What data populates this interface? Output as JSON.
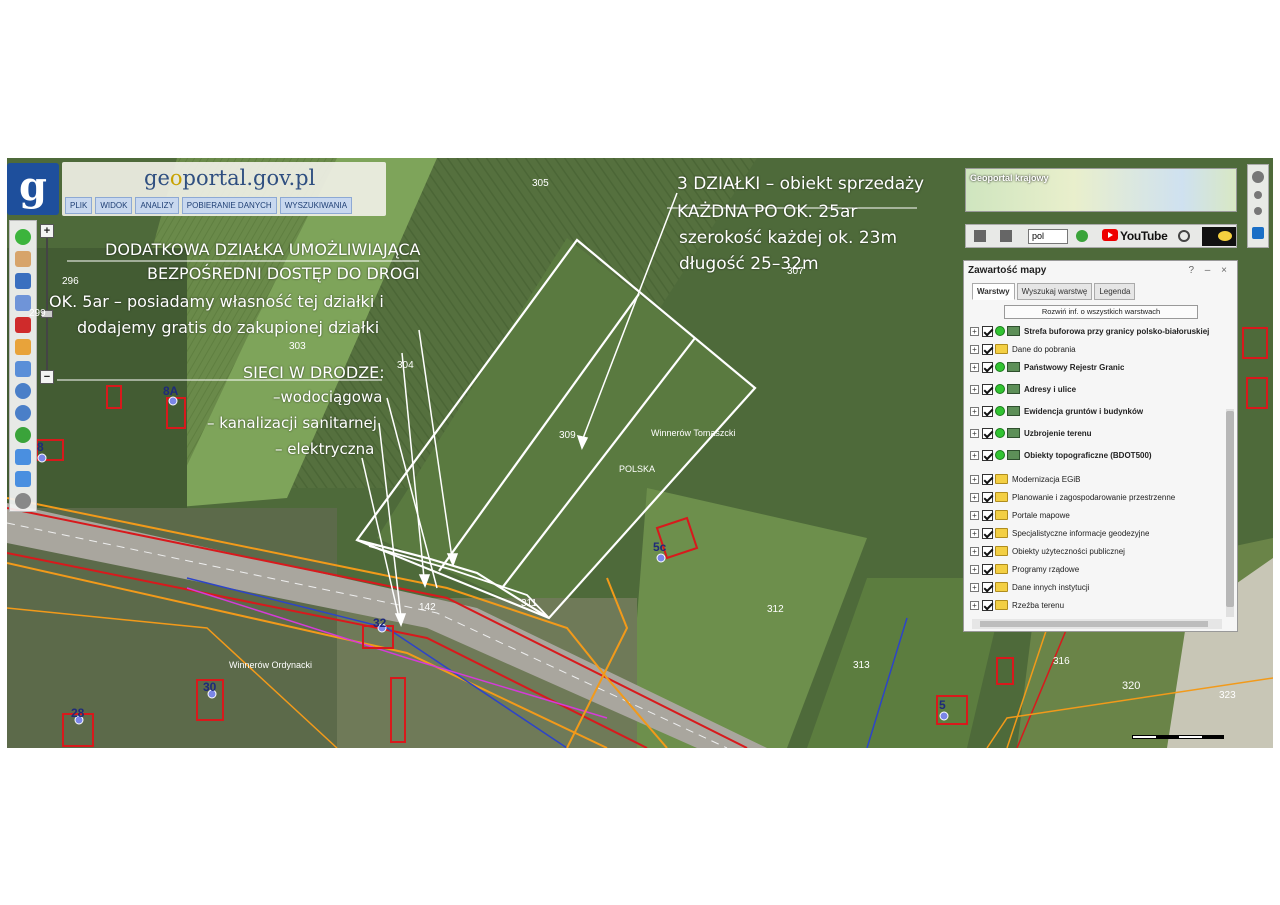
{
  "header": {
    "logo_letter": "g",
    "site_title_prefix": "ge",
    "site_title_o": "o",
    "site_title_rest": "portal.gov.pl",
    "menu": [
      "PLIK",
      "WIDOK",
      "ANALIZY",
      "POBIERANIE DANYCH",
      "WYSZUKIWANIA"
    ]
  },
  "zoom": {
    "plus": "+",
    "minus": "−"
  },
  "minimap": {
    "label": "Geoportal krajowy"
  },
  "toolbar2": {
    "language": "pol",
    "youtube": "YouTube"
  },
  "panel": {
    "title": "Zawartość mapy",
    "controls": "? – ×",
    "tabs": [
      "Warstwy",
      "Wyszukaj warstwę",
      "Legenda"
    ],
    "expand_button": "Rozwiń inf. o wszystkich warstwach",
    "layers": [
      {
        "name": "Strefa buforowa przy granicy polsko-białoruskiej",
        "type": "wms",
        "bold": true
      },
      {
        "name": "Dane do pobrania",
        "type": "folder",
        "bold": false
      },
      {
        "name": "Państwowy Rejestr Granic",
        "type": "wms",
        "bold": true
      },
      {
        "name": "Adresy i ulice",
        "type": "wms",
        "bold": true
      },
      {
        "name": "Ewidencja gruntów i budynków",
        "type": "wms",
        "bold": true
      },
      {
        "name": "Uzbrojenie terenu",
        "type": "wms",
        "bold": true
      },
      {
        "name": "Obiekty topograficzne (BDOT500)",
        "type": "wms",
        "bold": true
      },
      {
        "name": "Modernizacja EGiB",
        "type": "folder",
        "bold": false
      },
      {
        "name": "Planowanie i zagospodarowanie przestrzenne",
        "type": "folder",
        "bold": false
      },
      {
        "name": "Portale mapowe",
        "type": "folder",
        "bold": false
      },
      {
        "name": "Specjalistyczne informacje geodezyjne",
        "type": "folder",
        "bold": false
      },
      {
        "name": "Obiekty użyteczności publicznej",
        "type": "folder",
        "bold": false
      },
      {
        "name": "Programy rządowe",
        "type": "folder",
        "bold": false
      },
      {
        "name": "Dane innych instytucji",
        "type": "folder",
        "bold": false
      },
      {
        "name": "Rzeźba terenu",
        "type": "folder",
        "bold": false
      }
    ]
  },
  "annotations": {
    "sale_title": "3 DZIAŁKI – obiekt sprzedaży",
    "sale_each": "KAŻDNA PO OK. 25ar",
    "sale_width": "szerokość każdej ok. 23m",
    "sale_length": "długość 25–32m",
    "extra_line1": "DODATKOWA DZIAŁKA UMOŻLIWIAJĄCA",
    "extra_line2": "BEZPOŚREDNI DOSTĘP DO DROGI",
    "extra_line3": "OK. 5ar – posiadamy własność tej działki i",
    "extra_line4": "dodajemy gratis do zakupionej działki",
    "nets_title": "SIECI W DRODZE:",
    "nets_1": "–wodociągowa",
    "nets_2": "– kanalizacji sanitarnej",
    "nets_3": "– elektryczna"
  },
  "map_labels": {
    "p305": "305",
    "p307": "307",
    "p296": "296",
    "p299": "299",
    "p303": "303",
    "p304": "304",
    "p309": "309",
    "p311": "311",
    "p312": "312",
    "p313": "313",
    "p316": "316",
    "p320": "320",
    "p323": "323",
    "p142": "142",
    "place1": "Winnerów Tomaszcki",
    "place2": "POLSKA",
    "place3": "Winnerów Ordynacki"
  },
  "parcel_numbers": {
    "n8a": "8A",
    "n5c": "5c",
    "n32": "32",
    "n30": "30",
    "n28": "28",
    "n5": "5",
    "n8": "8"
  }
}
